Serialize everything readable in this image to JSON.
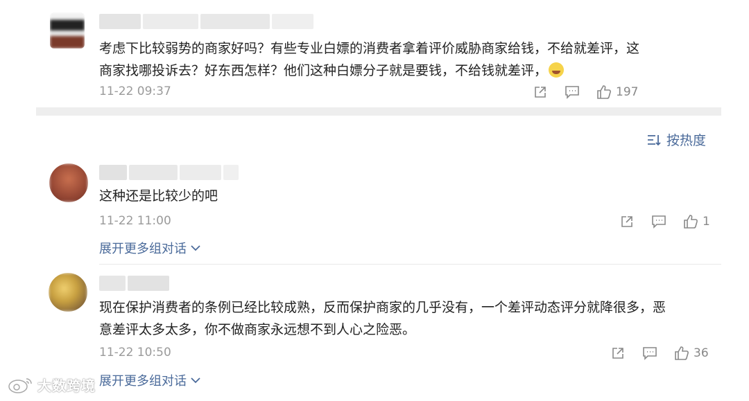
{
  "comments": [
    {
      "text_lines": [
        "考虑下比较弱势的商家好吗？有些专业白嫖的消费者拿着评价威胁商家给钱，不给就差评，这",
        "商家找哪投诉去？好东西怎样？他们这种白嫖分子就是要钱，不给钱就差评，"
      ],
      "emoji_icon": "laugh-cry-emoji",
      "time": "11-22 09:37",
      "likes": "197"
    },
    {
      "text_lines": [
        "这种还是比较少的吧"
      ],
      "time": "11-22 11:00",
      "likes": "1",
      "expand_label": "展开更多组对话"
    },
    {
      "text_lines": [
        "现在保护消费者的条例已经比较成熟，反而保护商家的几乎没有，一个差评动态评分就降很多，恶",
        "意差评太多太多，你不做商家永远想不到人心之险恶。"
      ],
      "time": "11-22 10:50",
      "likes": "36",
      "expand_label": "展开更多组对话"
    }
  ],
  "sort": {
    "label": "按热度",
    "icon": "sort-icon"
  },
  "watermark": {
    "text": "大数跨境",
    "icon": "weibo-logo-icon"
  },
  "colors": {
    "link": "#4a6a9a",
    "muted": "#9a9a9a",
    "band": "#eeeeee"
  }
}
